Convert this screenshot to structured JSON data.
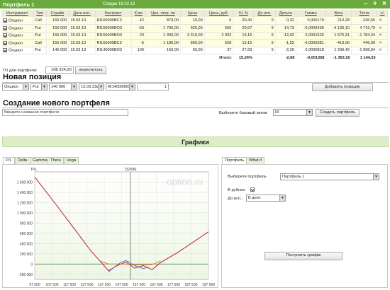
{
  "window": {
    "title": "Портфель 1",
    "created": "Создан 18.02.13"
  },
  "colors": {
    "header": "#6aaa3c",
    "chart_line": "#c0304a",
    "chart_line2": "#3a6ad8",
    "chart_line3": "#e07020",
    "plot_bg": "#eef6e4"
  },
  "table": {
    "headers": [
      "Инструмент",
      "Тип",
      "Страйк",
      "Дата исп.",
      "Контракт",
      "К-во",
      "Цен. откр. по",
      "Цена",
      "Цена, руб.",
      "IV, %",
      "До исп.",
      "Дельта",
      "Гамма",
      "Вега",
      "Тетта",
      "+/-"
    ],
    "rows": [
      [
        "Опцион",
        "Call",
        "165 000",
        "15.03.13",
        "RI165000BC3",
        "42",
        "870,00",
        "10,00",
        "6",
        "20,42",
        "9",
        "0,32",
        "0,000179",
        "210,28",
        "-236,55"
      ],
      [
        "Опцион",
        "Put",
        "150 000",
        "15.03.13",
        "RI150000BO3",
        "-50",
        "1 790,00",
        "920,00",
        "555",
        "20,57",
        "9",
        "14,73",
        "-0,0003499",
        "-4 130,10",
        "4 719,79"
      ],
      [
        "Опцион",
        "Put",
        "155 000",
        "15.03.13",
        "RI155000BO3",
        "20",
        "1 900,00",
        "3 310,00",
        "2 032",
        "19,16",
        "9",
        "-13,92",
        "0,0001525",
        "1 676,31",
        "-1 784,34"
      ],
      [
        "Опцион",
        "Call",
        "155 000",
        "15.03.13",
        "RI155000BC3",
        "-5",
        "1 180,00",
        "860,00",
        "528",
        "19,16",
        "9",
        "-1,52",
        "-0,0000381",
        "-419,06",
        "446,09"
      ],
      [
        "Опцион",
        "Put",
        "140 000",
        "15.03.13",
        "RI140000BO3",
        "100",
        "150,00",
        "60,00",
        "37",
        "27,69",
        "9",
        "-2,29",
        "0,0000818",
        "1 299,42",
        "-1 998,84"
      ]
    ],
    "totals": {
      "label": "Итого:",
      "iv": "15,24%",
      "delta": "-2,68",
      "gamma": "-0,001358",
      "vega": "-1 363,16",
      "theta": "1 144,03"
    }
  },
  "go": {
    "label": "ГО для портфеля:",
    "value": "108 324,20",
    "recalc": "пересчитать"
  },
  "new_position": {
    "title": "Новая позиция",
    "type": "Опцион",
    "kind": "Put",
    "strike": "140 000",
    "date": "15.03.13м",
    "contract": "RI140000BO3",
    "qty": "1",
    "add": "Добавить позицию"
  },
  "new_portfolio": {
    "title": "Создание нового портфеля",
    "name_placeholder": "Введите название портфеля",
    "base_label": "Выберите базовый актив",
    "base_value": "RI",
    "create": "Создать портфель"
  },
  "graphs": {
    "title": "Графики"
  },
  "chart_tabs": [
    "P/L",
    "Delta",
    "Gamma",
    "Theta",
    "Vega"
  ],
  "right_tabs": [
    "Портфель",
    "What if"
  ],
  "right_panel": {
    "portfolio_label": "Выберите портфель",
    "portfolio_value": "Портфель 1",
    "rub_label": "В рублях:",
    "until_label": "До исп.:",
    "until_value": "В днях",
    "build": "Построить график"
  },
  "chart_data": {
    "type": "line",
    "ylabel": "P/L",
    "watermark": "option.ru",
    "marker_label": "152580",
    "marker_x": 152580,
    "xlim": [
      97500,
      197500
    ],
    "ylim": [
      -300000,
      1800000
    ],
    "x_ticks": [
      "97 500",
      "107 500",
      "117 500",
      "127 500",
      "137 500",
      "147 500",
      "157 500",
      "167 500",
      "177 500",
      "187 500",
      "197 500"
    ],
    "y_ticks": [
      "1 600 000",
      "1 400 000",
      "1 200 000",
      "1 000 000",
      "800 000",
      "600 000",
      "400 000",
      "200 000",
      "0",
      "-200 000"
    ],
    "series": [
      {
        "x": [
          97500,
          110000,
          120000,
          130000,
          140000,
          145000,
          150000,
          155000,
          160000,
          165000,
          170000,
          180000,
          197500
        ],
        "values": [
          1700000,
          1150000,
          700000,
          250000,
          -130000,
          -30000,
          40000,
          -80000,
          -30000,
          -110000,
          30000,
          230000,
          630000
        ]
      },
      {
        "x": [
          140000,
          143000,
          147000,
          150000,
          155000,
          160000,
          163000
        ],
        "values": [
          -150000,
          -70000,
          30000,
          70000,
          -30000,
          -90000,
          -60000
        ]
      },
      {
        "x": [
          135000,
          140000,
          145000,
          150000,
          155000,
          160000,
          165000,
          170000
        ],
        "values": [
          60000,
          0,
          0,
          0,
          -20000,
          -10000,
          -10000,
          60000
        ]
      }
    ]
  }
}
